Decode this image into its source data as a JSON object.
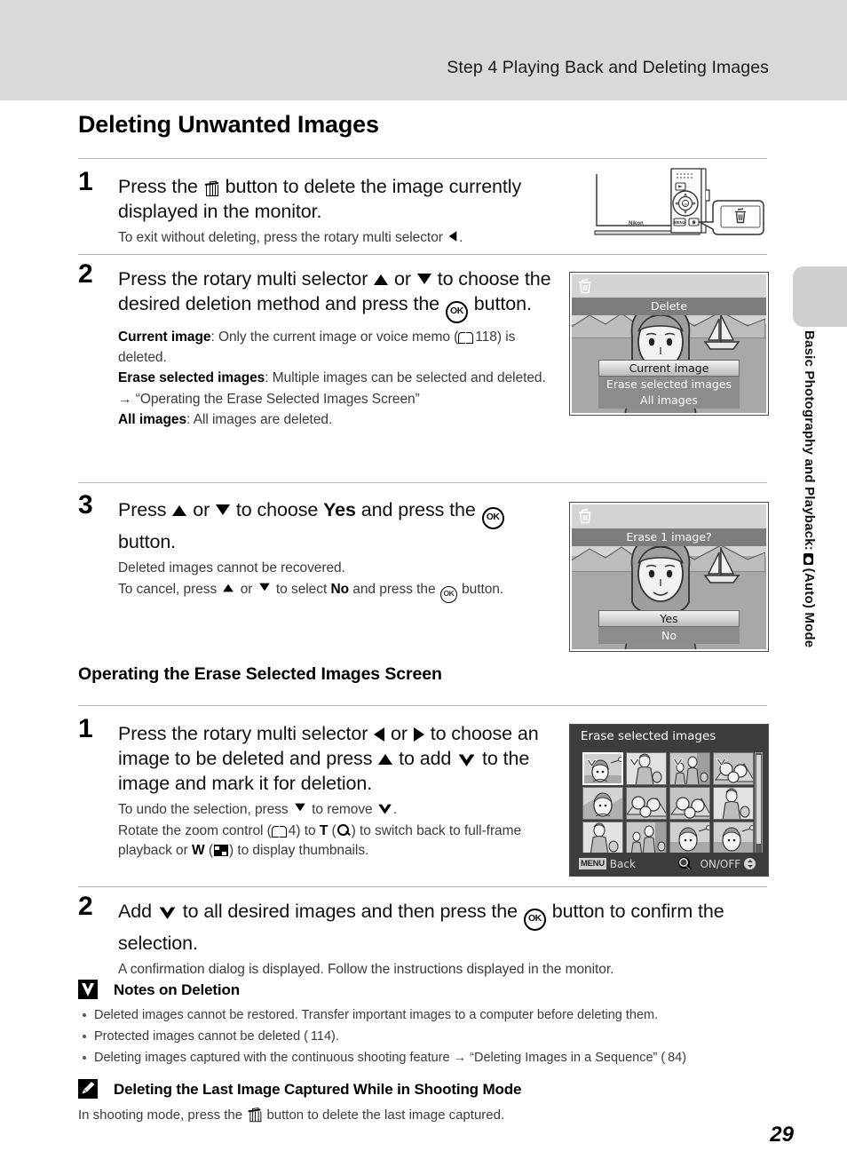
{
  "header": {
    "running_title": "Step 4 Playing Back and Deleting Images"
  },
  "side_tab": {
    "label_before": "Basic Photography and Playback: ",
    "icon": "camera-auto-icon",
    "label_after": " (Auto) Mode"
  },
  "page_title": "Deleting Unwanted Images",
  "section_title": "Operating the Erase Selected Images Screen",
  "page_number": "29",
  "steps_main": [
    {
      "number": "1",
      "lead_a": "Press the ",
      "lead_icon": "trash-icon",
      "lead_b": " button to delete the image currently displayed in the monitor.",
      "note_a": "To exit without deleting, press the rotary multi selector ",
      "note_icon": "triangle-left-icon",
      "note_b": "."
    },
    {
      "number": "2",
      "lead_a": "Press the rotary multi selector ",
      "lead_icon1": "triangle-up-icon",
      "lead_mid": " or ",
      "lead_icon2": "triangle-down-icon",
      "lead_b": " to choose the desired deletion method and press the ",
      "lead_icon3": "ok-button-icon",
      "lead_c": " button.",
      "notes": [
        {
          "term": "Current image",
          "text_a": ": Only the current image or voice memo (",
          "book_ref": "118",
          "text_b": ") is deleted."
        },
        {
          "term": "Erase selected images",
          "text_a": ": Multiple images can be selected and deleted."
        },
        {
          "arrow_line": "→ “Operating the Erase Selected Images Screen”"
        },
        {
          "term": "All images",
          "text_a": ": All images are deleted."
        }
      ]
    },
    {
      "number": "3",
      "lead_a": "Press ",
      "lead_icon1": "triangle-up-icon",
      "lead_mid": " or ",
      "lead_icon2": "triangle-down-icon",
      "lead_b": " to choose ",
      "lead_bold": "Yes",
      "lead_c": " and press the ",
      "lead_icon3": "ok-button-icon",
      "lead_d": " button.",
      "note1": "Deleted images cannot be recovered.",
      "note2_a": "To cancel, press ",
      "note2_b": " or ",
      "note2_c": " to select ",
      "note2_bold": "No",
      "note2_d": " and press the ",
      "note2_e": " button."
    }
  ],
  "steps_sub": [
    {
      "number": "1",
      "lead_a": "Press the rotary multi selector ",
      "lead_mid": " or ",
      "lead_b": " to choose an image to be deleted and press ",
      "lead_c": " to add ",
      "lead_d": " to the image and mark it for deletion.",
      "note1_a": "To undo the selection, press ",
      "note1_b": " to remove ",
      "note1_c": ".",
      "note2_a": "Rotate the zoom control (",
      "note2_ref": "4",
      "note2_b": ") to ",
      "note2_T": "T",
      "note2_c": " (",
      "note2_d": ") to switch back to full-frame playback or ",
      "note2_W": "W",
      "note2_e": " (",
      "note2_f": ") to display thumbnails."
    },
    {
      "number": "2",
      "lead_a": "Add ",
      "lead_b": " to all desired images and then press the ",
      "lead_c": " button to confirm the selection.",
      "note": "A confirmation dialog is displayed. Follow the instructions displayed in the monitor."
    }
  ],
  "notes_deletion": {
    "icon": "caution-icon",
    "heading": "Notes on Deletion",
    "bullets": [
      "Deleted images cannot be restored. Transfer important images to a computer before deleting them.",
      "Protected images cannot be deleted ( 114).",
      "Deleting images captured with the continuous shooting feature → “Deleting Images in a Sequence” ( 84)"
    ]
  },
  "notes_last_image": {
    "icon": "pencil-icon",
    "heading": "Deleting the Last Image Captured While in Shooting Mode",
    "body_a": "In shooting mode, press the ",
    "body_b": " button to delete the last image captured."
  },
  "lcd_delete_menu": {
    "title": "Delete",
    "items": [
      "Current image",
      "Erase selected images",
      "All images"
    ],
    "selected_index": 0
  },
  "lcd_confirm": {
    "title": "Erase 1 image?",
    "items": [
      "Yes",
      "No"
    ],
    "selected_index": 0
  },
  "lcd_thumbs": {
    "title": "Erase selected images",
    "footer_menu_chip": "MENU",
    "footer_back": "Back",
    "footer_onoff": "ON/OFF",
    "rows": 3,
    "cols": 4,
    "checked_cells": [
      0,
      1,
      2,
      3
    ],
    "selected_cell": 0
  },
  "camera_illustration": {
    "brand": "Nikon",
    "callout_icon": "trash-icon",
    "menu_button_label": "MENU"
  },
  "colors": {
    "header_band": "#d9d9d9",
    "rule": "#b9b9b9",
    "lcd_bg": "#9a9a9a",
    "lcd_title_bar": "#7d7d7d",
    "grid_chrome": "#3d3d3d"
  }
}
